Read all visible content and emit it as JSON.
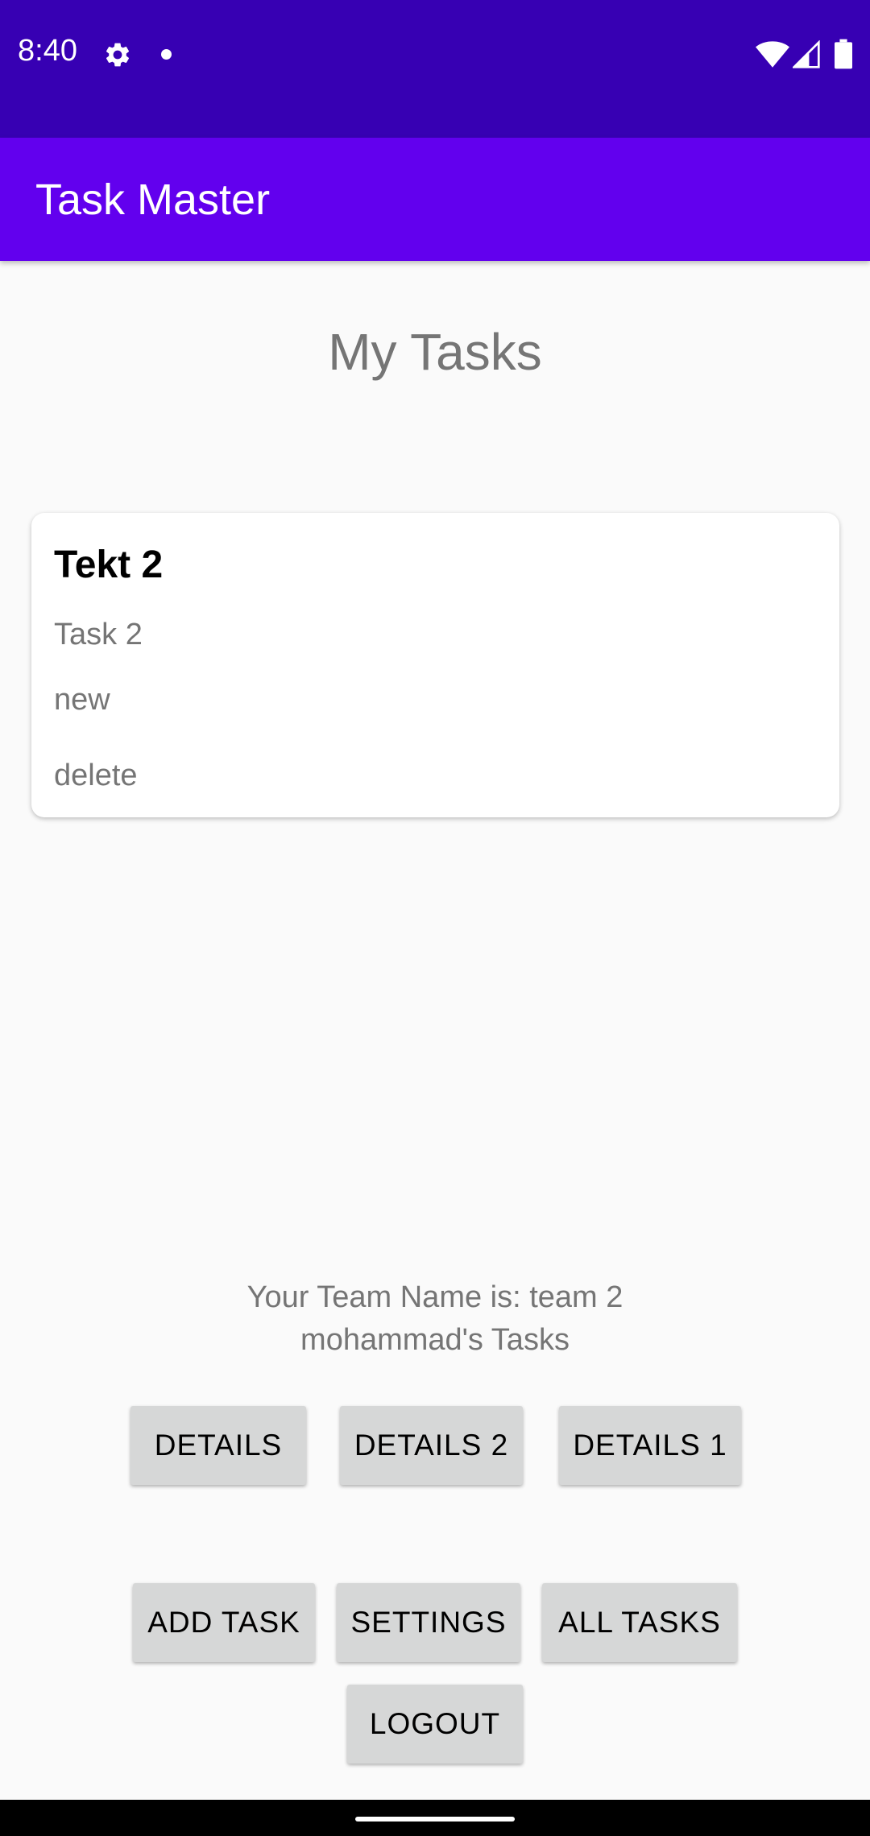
{
  "status_bar": {
    "time": "8:40",
    "icons": [
      "gear-icon",
      "notification-dot-icon",
      "wifi-icon",
      "signal-icon",
      "battery-icon"
    ]
  },
  "app_bar": {
    "title": "Task Master"
  },
  "main": {
    "title": "My Tasks",
    "tasks": [
      {
        "title": "Tekt 2",
        "body": "Task 2",
        "state": "new",
        "delete_label": "delete"
      }
    ],
    "team_line": "Your Team Name is: team 2",
    "user_line": "mohammad's Tasks"
  },
  "buttons": {
    "details": "DETAILS",
    "details_2": "DETAILS 2",
    "details_1": "DETAILS 1",
    "add_task": "ADD TASK",
    "settings": "SETTINGS",
    "all_tasks": "ALL TASKS",
    "logout": "LOGOUT"
  },
  "colors": {
    "status_bar": "#3700b3",
    "app_bar": "#6200ee",
    "button_bg": "#d6d7d7",
    "secondary_text": "#757575"
  }
}
